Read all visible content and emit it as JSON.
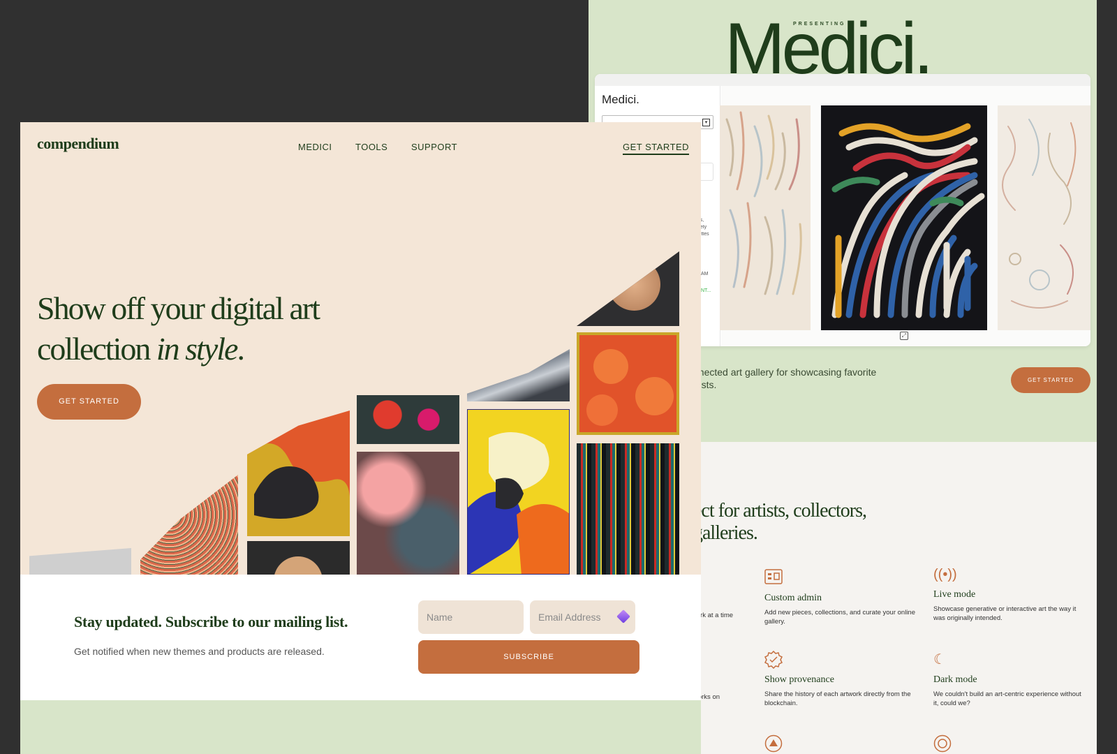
{
  "back_page": {
    "presenting": "PRESENTING",
    "title": "Medici.",
    "app": {
      "logo": "Medici.",
      "sidebar_fragments": [
        "ries,",
        "ariety",
        "alettes",
        "t.",
        "AM",
        "INT..."
      ]
    },
    "tagline": "nnected art gallery for showcasing favorite rtists.",
    "cta_label": "GET STARTED",
    "section_title_line1": "ect for artists, collectors,",
    "section_title_line2": "galleries.",
    "fragments": [
      "vork at a time",
      "e.",
      "works on"
    ],
    "features": [
      {
        "icon": "custom-admin-icon",
        "title": "Custom admin",
        "desc": "Add new pieces, collections, and curate your online gallery."
      },
      {
        "icon": "live-mode-icon",
        "title": "Live mode",
        "desc": "Showcase generative or interactive art the way it was originally intended."
      },
      {
        "icon": "provenance-icon",
        "title": "Show provenance",
        "desc": "Share the history of each artwork directly from the blockchain."
      },
      {
        "icon": "dark-mode-icon",
        "title": "Dark mode",
        "desc": "We couldn't build an art-centric experience without it, could we?"
      }
    ],
    "colors": {
      "accent": "#c46e3e",
      "green_bg": "#d8e5c9",
      "dark_green": "#1f3d1b"
    }
  },
  "front_page": {
    "nav": {
      "logo": "compendium",
      "links": [
        "MEDICI",
        "TOOLS",
        "SUPPORT"
      ],
      "cta": "GET STARTED"
    },
    "hero": {
      "headline_line1": "Show off your digital art",
      "headline_line2_plain": "collection ",
      "headline_line2_italic": "in style",
      "headline_line2_end": ".",
      "cta": "GET STARTED"
    },
    "subscribe": {
      "title": "Stay updated. Subscribe to our mailing list.",
      "desc": "Get notified when new themes and products are released.",
      "name_placeholder": "Name",
      "email_placeholder": "Email Address",
      "button": "SUBSCRIBE"
    },
    "colors": {
      "page_bg": "#f4e6d7",
      "accent": "#c46e3e",
      "text": "#1f3d1b"
    }
  }
}
